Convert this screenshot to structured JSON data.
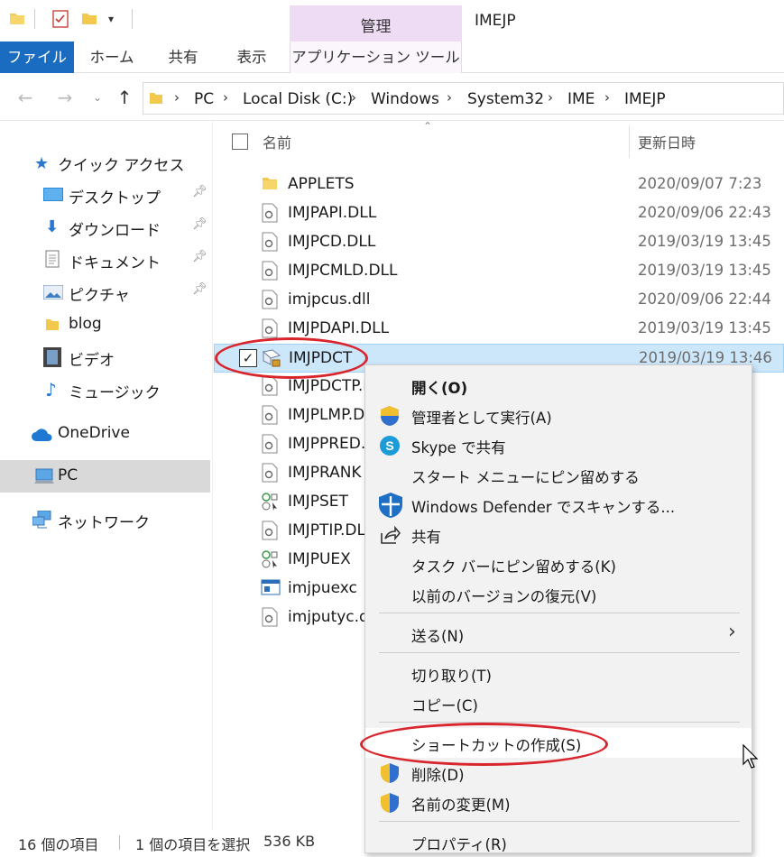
{
  "window": {
    "title": "IMEJP",
    "context_tab_header": "管理"
  },
  "ribbon": {
    "tabs": [
      {
        "label": "ファイル"
      },
      {
        "label": "ホーム"
      },
      {
        "label": "共有"
      },
      {
        "label": "表示"
      },
      {
        "label": "アプリケーション ツール"
      }
    ]
  },
  "address_bar": {
    "breadcrumbs": [
      "PC",
      "Local Disk (C:)",
      "Windows",
      "System32",
      "IME",
      "IMEJP"
    ]
  },
  "navigation": {
    "items": [
      {
        "label": "クイック アクセス",
        "icon": "star-icon"
      },
      {
        "label": "デスクトップ",
        "icon": "desktop-icon",
        "pinned": true
      },
      {
        "label": "ダウンロード",
        "icon": "download-icon",
        "pinned": true
      },
      {
        "label": "ドキュメント",
        "icon": "document-icon",
        "pinned": true
      },
      {
        "label": "ピクチャ",
        "icon": "pictures-icon",
        "pinned": true
      },
      {
        "label": "blog",
        "icon": "folder-icon"
      },
      {
        "label": "ビデオ",
        "icon": "video-icon"
      },
      {
        "label": "ミュージック",
        "icon": "music-icon"
      },
      {
        "label": "OneDrive",
        "icon": "cloud-icon"
      },
      {
        "label": "PC",
        "icon": "computer-icon",
        "selected": true
      },
      {
        "label": "ネットワーク",
        "icon": "network-icon"
      }
    ]
  },
  "file_list": {
    "columns": {
      "name": "名前",
      "modified": "更新日時"
    },
    "rows": [
      {
        "name": "APPLETS",
        "date": "2020/09/07 7:23",
        "icon": "folder-icon"
      },
      {
        "name": "IMJPAPI.DLL",
        "date": "2020/09/06 22:43",
        "icon": "dll-file-icon"
      },
      {
        "name": "IMJPCD.DLL",
        "date": "2019/03/19 13:45",
        "icon": "dll-file-icon"
      },
      {
        "name": "IMJPCMLD.DLL",
        "date": "2019/03/19 13:45",
        "icon": "dll-file-icon"
      },
      {
        "name": "imjpcus.dll",
        "date": "2020/09/06 22:44",
        "icon": "dll-file-icon"
      },
      {
        "name": "IMJPDAPI.DLL",
        "date": "2019/03/19 13:45",
        "icon": "dll-file-icon"
      },
      {
        "name": "IMJPDCT",
        "date": "2019/03/19 13:46",
        "icon": "app-file-icon",
        "selected": true
      },
      {
        "name": "IMJPDCTP.D",
        "date": "46",
        "icon": "dll-file-icon"
      },
      {
        "name": "IMJPLMP.D",
        "date": "45",
        "icon": "dll-file-icon"
      },
      {
        "name": "IMJPPRED.",
        "date": "45",
        "icon": "dll-file-icon"
      },
      {
        "name": "IMJPRANK",
        "date": "45",
        "icon": "dll-file-icon"
      },
      {
        "name": "IMJPSET",
        "date": "46",
        "icon": "settings-exe-icon"
      },
      {
        "name": "IMJPTIP.DLL",
        "date": "44",
        "icon": "dll-file-icon"
      },
      {
        "name": "IMJPUEX",
        "date": "46",
        "icon": "settings-exe-icon"
      },
      {
        "name": "imjpuexc",
        "date": "45",
        "icon": "window-exe-icon"
      },
      {
        "name": "imjputyc.dl",
        "date": "46",
        "icon": "dll-file-icon"
      }
    ]
  },
  "context_menu": {
    "items": [
      {
        "label": "開く(O)",
        "bold": true
      },
      {
        "label": "管理者として実行(A)",
        "icon": "uac-shield-icon"
      },
      {
        "label": "Skype で共有",
        "icon": "skype-icon"
      },
      {
        "label": "スタート メニューにピン留めする"
      },
      {
        "label": "Windows Defender でスキャンする...",
        "icon": "defender-icon"
      },
      {
        "label": "共有",
        "icon": "share-icon"
      },
      {
        "label": "タスク バーにピン留めする(K)"
      },
      {
        "label": "以前のバージョンの復元(V)"
      },
      {
        "label": "送る(N)",
        "submenu": true
      },
      {
        "label": "切り取り(T)"
      },
      {
        "label": "コピー(C)"
      },
      {
        "label": "ショートカットの作成(S)",
        "highlighted": true
      },
      {
        "label": "削除(D)",
        "icon": "uac-shield-icon"
      },
      {
        "label": "名前の変更(M)",
        "icon": "uac-shield-icon"
      },
      {
        "label": "プロパティ(R)"
      }
    ]
  },
  "status_bar": {
    "item_count": "16 個の項目",
    "selection": "1 個の項目を選択",
    "size": "536 KB"
  },
  "colors": {
    "file_tab": "#1a6cc1",
    "context_tab": "#eedcf4",
    "selection": "#cce6fa",
    "annotation": "#d9262e"
  }
}
